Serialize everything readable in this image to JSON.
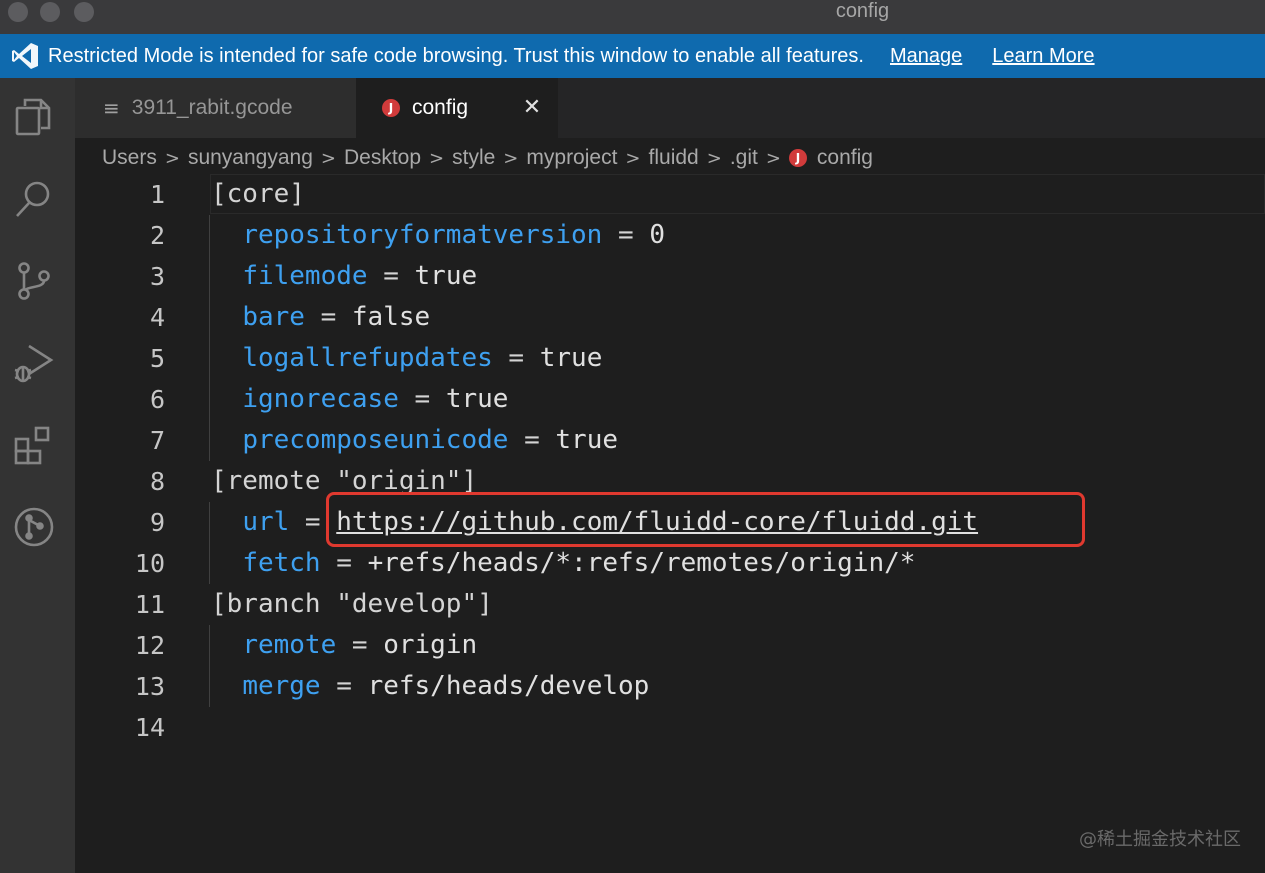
{
  "window": {
    "title": "config"
  },
  "banner": {
    "message": "Restricted Mode is intended for safe code browsing. Trust this window to enable all features.",
    "manage_label": "Manage",
    "learn_more_label": "Learn More",
    "background_color": "#0f6aae"
  },
  "activity_bar": {
    "icons": [
      "explorer-icon",
      "search-icon",
      "source-control-icon",
      "run-debug-icon",
      "extensions-icon",
      "git-graph-icon"
    ]
  },
  "tabs": [
    {
      "label": "3911_rabit.gcode",
      "icon": "lines-icon",
      "active": false
    },
    {
      "label": "config",
      "icon": "j-badge-icon",
      "active": true,
      "close_label": "✕"
    }
  ],
  "breadcrumb": {
    "items": [
      "Users",
      "sunyangyang",
      "Desktop",
      "style",
      "myproject",
      "fluidd",
      ".git",
      "config"
    ],
    "separator": ">"
  },
  "editor": {
    "lines": [
      {
        "n": "1",
        "key": "[core]",
        "op": "",
        "value": ""
      },
      {
        "n": "2",
        "key": "repositoryformatversion",
        "op": " = ",
        "value": "0"
      },
      {
        "n": "3",
        "key": "filemode",
        "op": " = ",
        "value": "true"
      },
      {
        "n": "4",
        "key": "bare",
        "op": " = ",
        "value": "false"
      },
      {
        "n": "5",
        "key": "logallrefupdates",
        "op": " = ",
        "value": "true"
      },
      {
        "n": "6",
        "key": "ignorecase",
        "op": " = ",
        "value": "true"
      },
      {
        "n": "7",
        "key": "precomposeunicode",
        "op": " = ",
        "value": "true"
      },
      {
        "n": "8",
        "key": "[remote \"origin\"]",
        "op": "",
        "value": ""
      },
      {
        "n": "9",
        "key": "url",
        "op": " = ",
        "value": "https://github.com/fluidd-core/fluidd.git"
      },
      {
        "n": "10",
        "key": "fetch",
        "op": " = ",
        "value": "+refs/heads/*:refs/remotes/origin/*"
      },
      {
        "n": "11",
        "key": "[branch \"develop\"]",
        "op": "",
        "value": ""
      },
      {
        "n": "12",
        "key": "remote",
        "op": " = ",
        "value": "origin"
      },
      {
        "n": "13",
        "key": "merge",
        "op": " = ",
        "value": "refs/heads/develop"
      },
      {
        "n": "14",
        "key": "",
        "op": "",
        "value": ""
      }
    ],
    "highlight_color": "#e0392f"
  },
  "watermark": "@稀土掘金技术社区"
}
